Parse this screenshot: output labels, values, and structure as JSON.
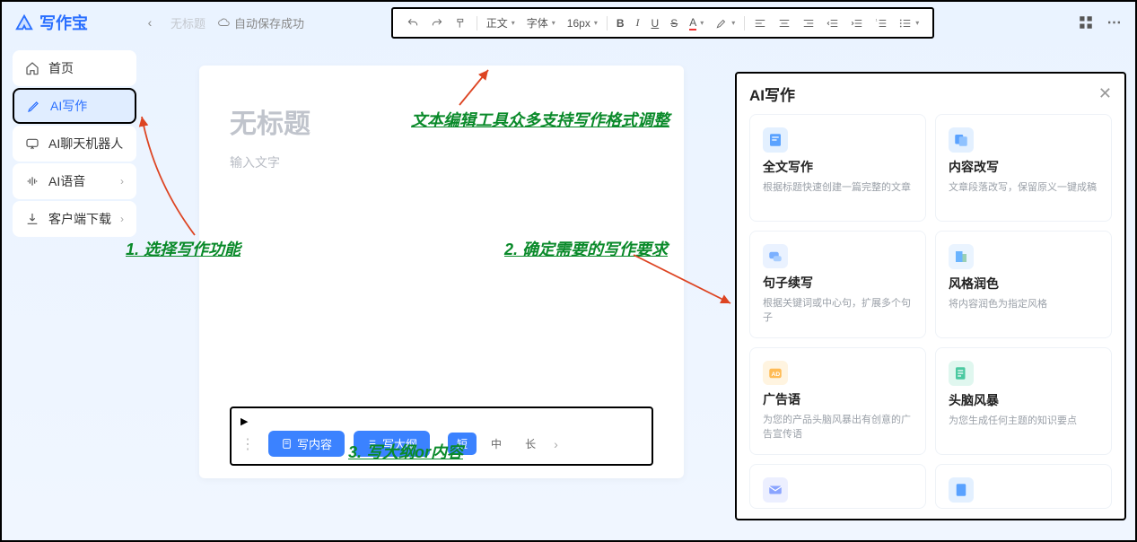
{
  "app": {
    "name": "写作宝"
  },
  "topbar": {
    "tab_untitled": "无标题",
    "autosave": "自动保存成功"
  },
  "sidebar": {
    "items": [
      {
        "label": "首页"
      },
      {
        "label": "AI写作"
      },
      {
        "label": "AI聊天机器人"
      },
      {
        "label": "AI语音"
      },
      {
        "label": "客户端下载"
      }
    ]
  },
  "toolbar": {
    "heading": "正文",
    "font": "字体",
    "fontsize": "16px",
    "bold": "B",
    "italic": "I",
    "underline": "U",
    "strike": "S",
    "textcolor": "A"
  },
  "editor": {
    "title_placeholder": "无标题",
    "body_placeholder": "输入文字"
  },
  "bottombar": {
    "write_content": "写内容",
    "write_outline": "写大纲",
    "len_short": "短",
    "len_mid": "中",
    "len_long": "长"
  },
  "ai_panel": {
    "title": "AI写作",
    "cards": [
      {
        "title": "全文写作",
        "desc": "根据标题快速创建一篇完整的文章"
      },
      {
        "title": "内容改写",
        "desc": "文章段落改写，保留原义一键成稿"
      },
      {
        "title": "句子续写",
        "desc": "根据关键词或中心句，扩展多个句子"
      },
      {
        "title": "风格润色",
        "desc": "将内容润色为指定风格"
      },
      {
        "title": "广告语",
        "desc": "为您的产品头脑风暴出有创意的广告宣传语"
      },
      {
        "title": "头脑风暴",
        "desc": "为您生成任何主题的知识要点"
      }
    ]
  },
  "annotations": {
    "a1": "1. 选择写作功能",
    "a2": "2. 确定需要的写作要求",
    "a3": "3. 写大纲or内容",
    "a_toolbar": "文本编辑工具众多支持写作格式调整"
  }
}
